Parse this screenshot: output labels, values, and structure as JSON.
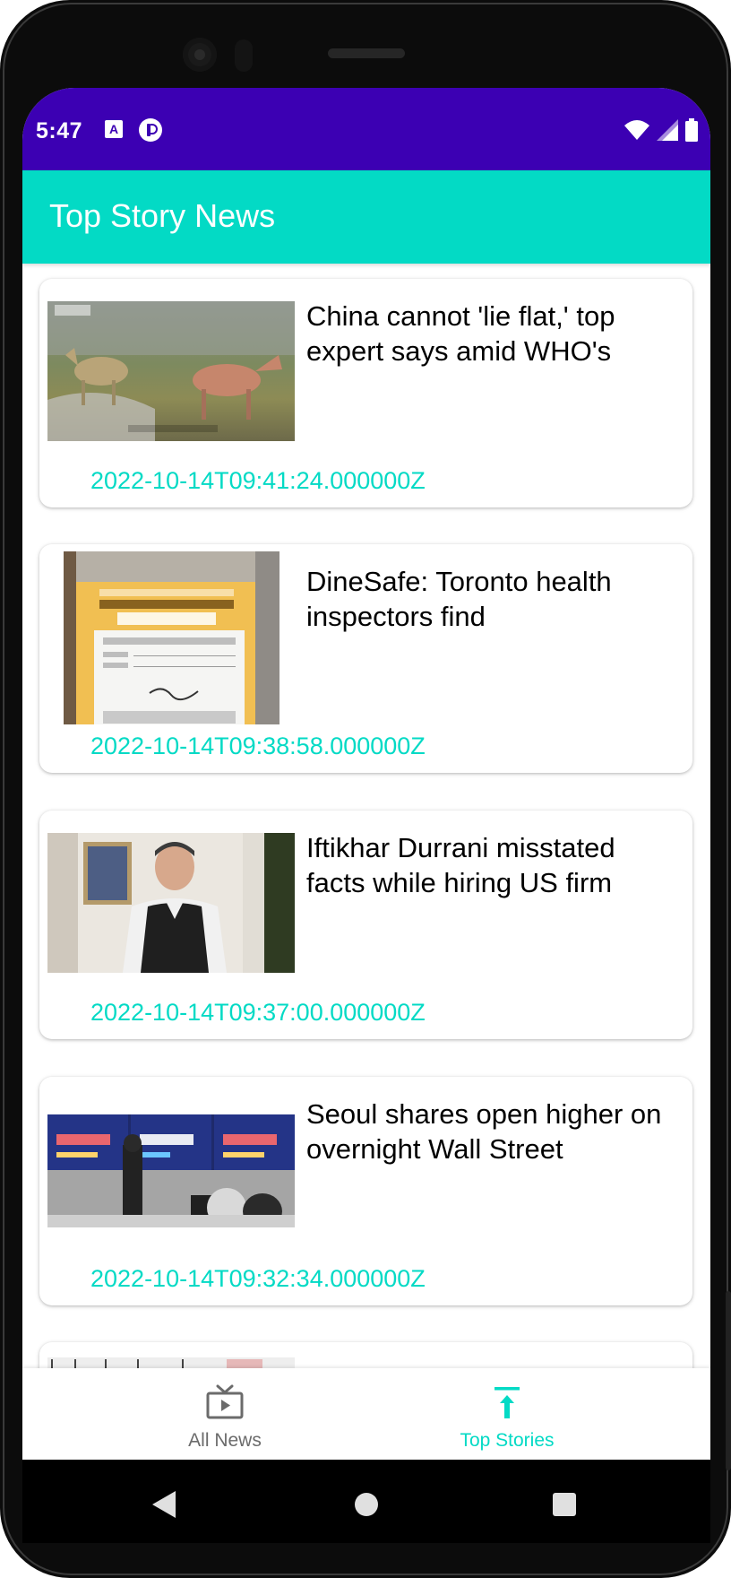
{
  "status_bar": {
    "time": "5:47"
  },
  "app_bar": {
    "title": "Top Story News"
  },
  "articles": [
    {
      "title": "China cannot 'lie flat,' top expert says amid WHO's",
      "date": "2022-10-14T09:41:24.000000Z",
      "image_icon": "photo-thumbnail-icon"
    },
    {
      "title": "DineSafe: Toronto health inspectors find",
      "date": "2022-10-14T09:38:58.000000Z",
      "image_icon": "photo-thumbnail-icon"
    },
    {
      "title": "Iftikhar Durrani misstated facts while hiring US firm",
      "date": "2022-10-14T09:37:00.000000Z",
      "image_icon": "photo-thumbnail-icon"
    },
    {
      "title": "Seoul shares open higher on overnight Wall Street",
      "date": "2022-10-14T09:32:34.000000Z",
      "image_icon": "photo-thumbnail-icon"
    }
  ],
  "bottom_nav": {
    "items": [
      {
        "label": "All News",
        "icon": "tv-icon",
        "active": false
      },
      {
        "label": "Top Stories",
        "icon": "arrow-up-to-top-icon",
        "active": true
      }
    ]
  },
  "colors": {
    "status_bar": "#3c00b3",
    "app_bar": "#03dac5",
    "accent": "#03dac5",
    "inactive": "#6b6b6b"
  }
}
